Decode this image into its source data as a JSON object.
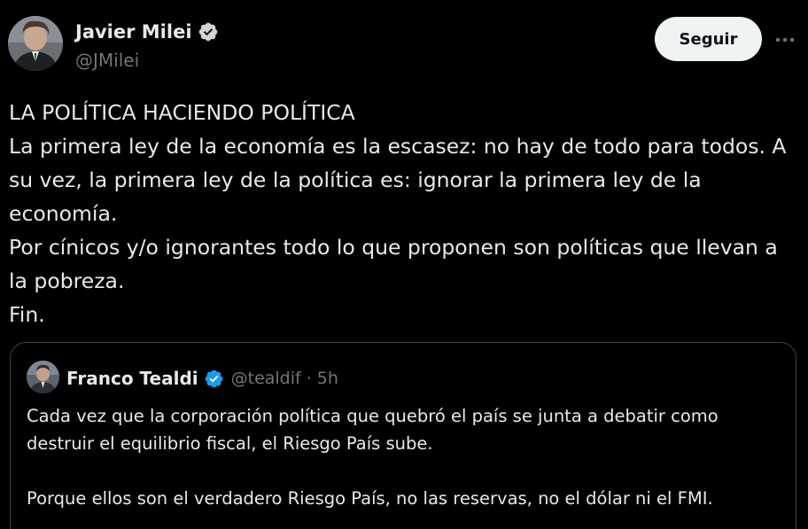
{
  "author": {
    "name": "Javier Milei",
    "handle": "@JMilei",
    "verified_icon": "verified-badge-icon",
    "avatar_icon": "profile-photo"
  },
  "actions": {
    "follow_label": "Seguir",
    "more_icon": "more-options-icon"
  },
  "tweet": {
    "lines": [
      "LA POLÍTICA HACIENDO POLÍTICA",
      "La primera ley de la economía es la escasez: no hay de todo para todos. A",
      "su vez, la primera ley de la política es: ignorar la primera ley de la",
      "economía.",
      "Por cínicos y/o ignorantes todo lo que proponen son políticas que llevan a",
      "la pobreza.",
      "Fin."
    ]
  },
  "quoted_tweet": {
    "name": "Franco Tealdi",
    "handle": "@tealdif",
    "separator": "·",
    "time": "5h",
    "paragraph1": [
      "Cada vez que la corporación política que quebró el país se junta a debatir como",
      "destruir el equilibrio fiscal, el Riesgo País sube."
    ],
    "paragraph2": [
      "Porque ellos son el verdadero Riesgo País, no las reservas, no el dólar ni el FMI."
    ]
  },
  "colors": {
    "background": "#000000",
    "text": "#e7e9ea",
    "secondary_text": "#71767b",
    "verified_blue": "#1d9bf0",
    "button_bg": "#eff3f4",
    "border": "#3f4349"
  }
}
